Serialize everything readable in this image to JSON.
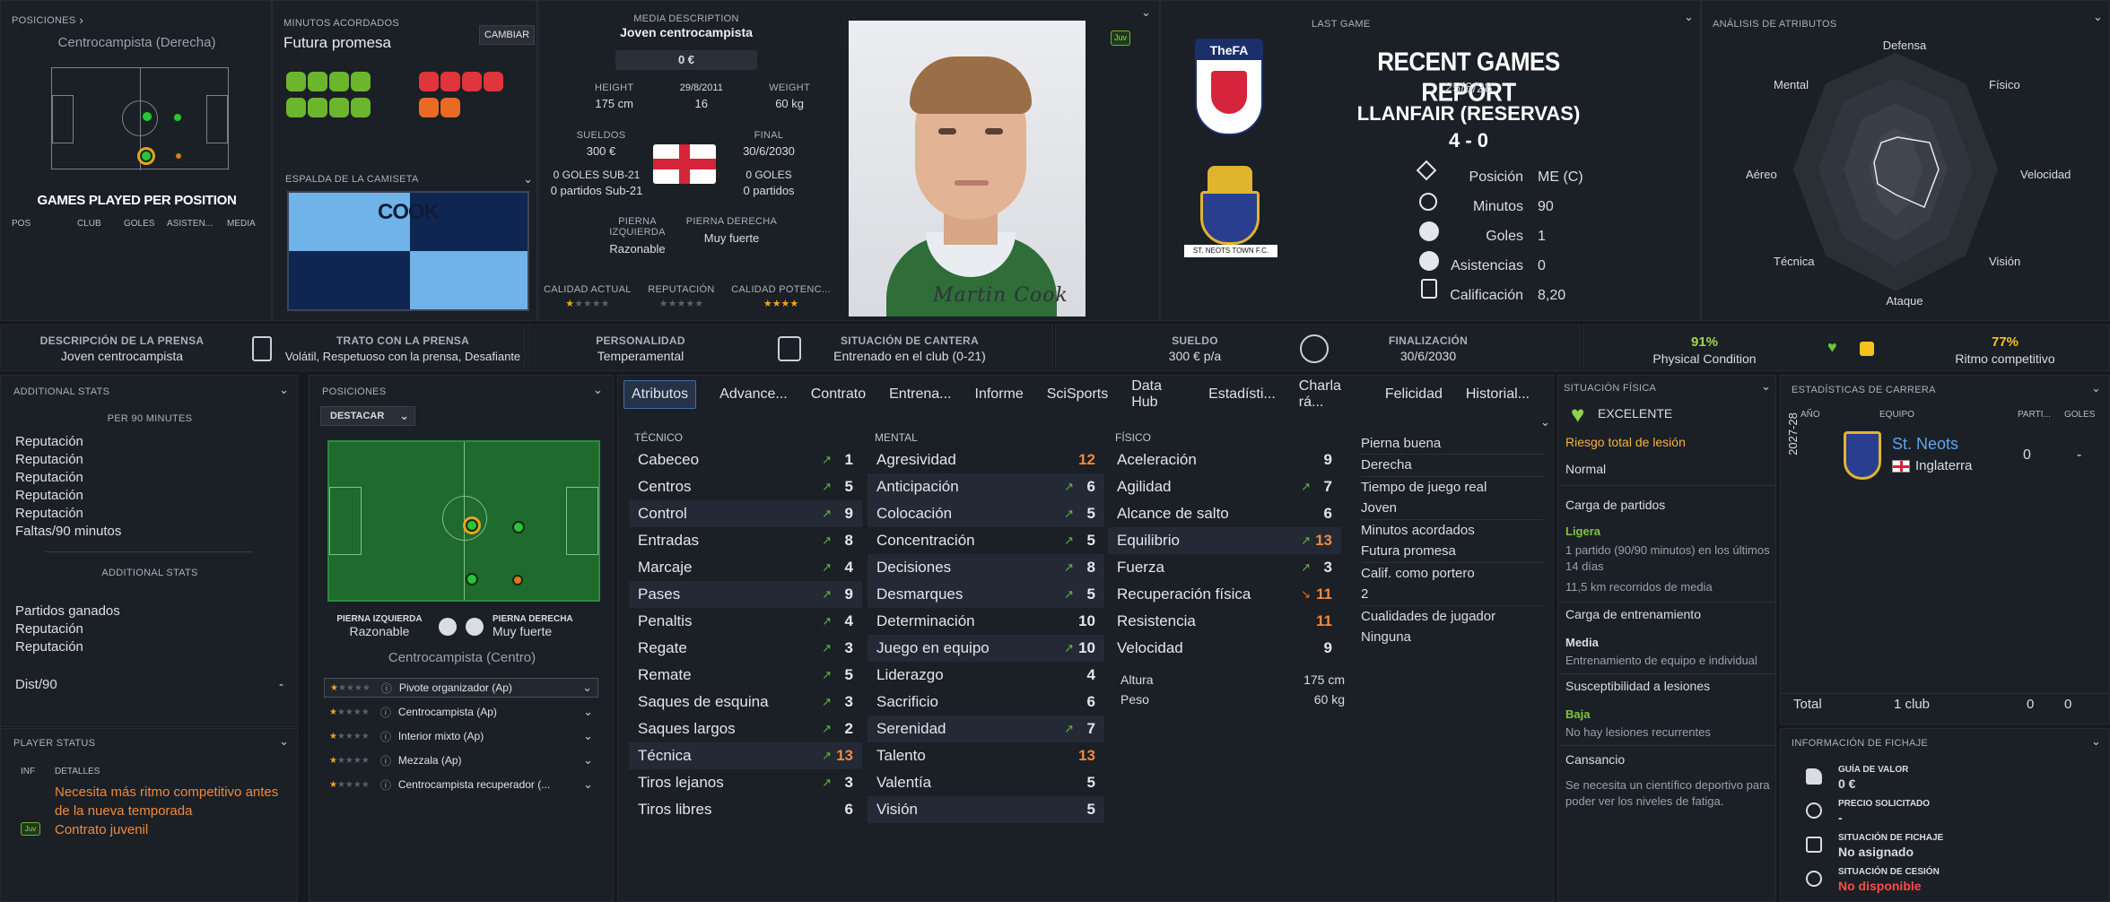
{
  "header_left": {
    "posiciones": "POSICIONES",
    "position_name": "Centrocampista (Derecha)",
    "games_played_title": "GAMES PLAYED PER POSITION",
    "cols": [
      "POS",
      "CLUB",
      "GOLES",
      "ASISTEN...",
      "MEDIA"
    ]
  },
  "minutos": {
    "label": "MINUTOS ACORDADOS",
    "value": "Futura promesa",
    "change_btn": "CAMBIAR"
  },
  "shirt": {
    "label": "ESPALDA DE LA CAMISETA",
    "name": "COOK"
  },
  "media": {
    "label": "MEDIA DESCRIPTION",
    "value": "Joven centrocampista",
    "value_money": "0 €",
    "badge": "Juv",
    "height_label": "HEIGHT",
    "height": "175 cm",
    "dob": "29/8/2011",
    "age": "16",
    "weight_label": "WEIGHT",
    "weight": "60 kg",
    "sueldos_label": "SUELDOS",
    "sueldos": "300 €",
    "final_label": "FINAL",
    "final": "30/6/2030",
    "goles_sub21": "0 GOLES SUB-21",
    "partidos_sub21": "0 partidos Sub-21",
    "goles": "0 GOLES",
    "partidos": "0 partidos",
    "pierna_izq_label": "PIERNA IZQUIERDA",
    "pierna_izq": "Razonable",
    "pierna_der_label": "PIERNA DERECHA",
    "pierna_der": "Muy fuerte",
    "calidad_actual": "CALIDAD ACTUAL",
    "reputacion": "REPUTACIÓN",
    "calidad_potencial": "CALIDAD POTENC...",
    "signature": "Martin Cook"
  },
  "last_game": {
    "label": "LAST GAME",
    "title": "RECENT GAMES REPORT",
    "date": "25/6/28",
    "opponent": "LLANFAIR (RESERVAS)",
    "score": "4 - 0",
    "badge_top": "TheFA",
    "badge_bottom": "ST. NEOTS TOWN F.C.",
    "rows": [
      {
        "k": "Posición",
        "v": "ME (C)"
      },
      {
        "k": "Minutos",
        "v": "90"
      },
      {
        "k": "Goles",
        "v": "1"
      },
      {
        "k": "Asistencias",
        "v": "0"
      },
      {
        "k": "Calificación",
        "v": "8,20"
      }
    ]
  },
  "analisis": {
    "label": "ANÁLISIS DE ATRIBUTOS",
    "axes": [
      "Defensa",
      "Físico",
      "Velocidad",
      "Visión",
      "Ataque",
      "Técnica",
      "Aéreo",
      "Mental"
    ]
  },
  "strip": {
    "prensa_label": "DESCRIPCIÓN DE LA PRENSA",
    "prensa": "Joven centrocampista",
    "trato_label": "TRATO CON LA PRENSA",
    "trato": "Volátil, Respetuoso con la prensa, Desafiante",
    "personalidad_label": "PERSONALIDAD",
    "personalidad": "Temperamental",
    "cantera_label": "SITUACIÓN DE CANTERA",
    "cantera": "Entrenado en el club (0-21)",
    "sueldo_label": "SUELDO",
    "sueldo": "300 € p/a",
    "finalizacion_label": "FINALIZACIÓN",
    "finalizacion": "30/6/2030",
    "physical_pct": "91%",
    "physical_label": "Physical Condition",
    "ritmo_pct": "77%",
    "ritmo_label": "Ritmo competitivo"
  },
  "additional": {
    "title": "ADDITIONAL STATS",
    "per90": "PER 90 MINUTES",
    "list1": [
      "Reputación",
      "Reputación",
      "Reputación",
      "Reputación",
      "Reputación",
      "Faltas/90 minutos"
    ],
    "sub": "ADDITIONAL STATS",
    "list2": [
      "Partidos ganados",
      "Reputación",
      "Reputación"
    ],
    "dist": "Dist/90",
    "dist_v": "-"
  },
  "player_status": {
    "title": "PLAYER STATUS",
    "inf": "INF",
    "detalles": "DETALLES",
    "msg1": "Necesita más ritmo competitivo antes de la nueva temporada",
    "badge": "Juv",
    "msg2": "Contrato juvenil"
  },
  "posiciones": {
    "title": "POSICIONES",
    "destacar": "DESTACAR",
    "pierna_izq_label": "PIERNA IZQUIERDA",
    "pierna_izq": "Razonable",
    "pierna_der_label": "PIERNA DERECHA",
    "pierna_der": "Muy fuerte",
    "position": "Centrocampista (Centro)",
    "roles": [
      "Pivote organizador (Ap)",
      "Centrocampista (Ap)",
      "Interior mixto (Ap)",
      "Mezzala (Ap)",
      "Centrocampista recuperador (..."
    ]
  },
  "tabs": [
    "Atributos",
    "Advance...",
    "Contrato",
    "Entrena...",
    "Informe",
    "SciSports",
    "Data Hub",
    "Estadísti...",
    "Charla rá...",
    "Felicidad",
    "Historial..."
  ],
  "tecnico": {
    "title": "TÉCNICO",
    "items": [
      {
        "n": "Cabeceo",
        "v": "1"
      },
      {
        "n": "Centros",
        "v": "5"
      },
      {
        "n": "Control",
        "v": "9"
      },
      {
        "n": "Entradas",
        "v": "8"
      },
      {
        "n": "Marcaje",
        "v": "4"
      },
      {
        "n": "Pases",
        "v": "9"
      },
      {
        "n": "Penaltis",
        "v": "4"
      },
      {
        "n": "Regate",
        "v": "3"
      },
      {
        "n": "Remate",
        "v": "5"
      },
      {
        "n": "Saques de esquina",
        "v": "3"
      },
      {
        "n": "Saques largos",
        "v": "2"
      },
      {
        "n": "Técnica",
        "v": "13"
      },
      {
        "n": "Tiros lejanos",
        "v": "3"
      },
      {
        "n": "Tiros libres",
        "v": "6"
      }
    ]
  },
  "mental": {
    "title": "MENTAL",
    "items": [
      {
        "n": "Agresividad",
        "v": "12"
      },
      {
        "n": "Anticipación",
        "v": "6"
      },
      {
        "n": "Colocación",
        "v": "5"
      },
      {
        "n": "Concentración",
        "v": "5"
      },
      {
        "n": "Decisiones",
        "v": "8"
      },
      {
        "n": "Desmarques",
        "v": "5"
      },
      {
        "n": "Determinación",
        "v": "10"
      },
      {
        "n": "Juego en equipo",
        "v": "10"
      },
      {
        "n": "Liderazgo",
        "v": "4"
      },
      {
        "n": "Sacrificio",
        "v": "6"
      },
      {
        "n": "Serenidad",
        "v": "7"
      },
      {
        "n": "Talento",
        "v": "13"
      },
      {
        "n": "Valentía",
        "v": "5"
      },
      {
        "n": "Visión",
        "v": "5"
      }
    ]
  },
  "fisico": {
    "title": "FÍSICO",
    "items": [
      {
        "n": "Aceleración",
        "v": "9"
      },
      {
        "n": "Agilidad",
        "v": "7"
      },
      {
        "n": "Alcance de salto",
        "v": "6"
      },
      {
        "n": "Equilibrio",
        "v": "13"
      },
      {
        "n": "Fuerza",
        "v": "3"
      },
      {
        "n": "Recuperación física",
        "v": "11"
      },
      {
        "n": "Resistencia",
        "v": "11"
      },
      {
        "n": "Velocidad",
        "v": "9"
      }
    ],
    "altura_label": "Altura",
    "altura": "175 cm",
    "peso_label": "Peso",
    "peso": "60 kg"
  },
  "info": {
    "items": [
      "Pierna buena",
      "Derecha",
      "Tiempo de juego real",
      "Joven",
      "Minutos acordados",
      "Futura promesa",
      "Calif. como portero",
      "2",
      "Cualidades de jugador",
      "Ninguna"
    ]
  },
  "situacion": {
    "title": "SITUACIÓN FÍSICA",
    "estado": "EXCELENTE",
    "riesgo": "Riesgo total de lesión",
    "riesgo_v": "Normal",
    "carga_partidos": "Carga de partidos",
    "carga_partidos_v": "Ligera",
    "carga_partidos_d1": "1 partido (90/90 minutos) en los últimos 14 días",
    "carga_partidos_d2": "11,5 km recorridos de media",
    "carga_entr": "Carga de entrenamiento",
    "carga_entr_v": "Media",
    "carga_entr_d": "Entrenamiento de equipo e individual",
    "suscept": "Susceptibilidad a lesiones",
    "suscept_v": "Baja",
    "suscept_d": "No hay lesiones recurrentes",
    "cansancio": "Cansancio",
    "cansancio_d": "Se necesita un científico deportivo para poder ver los niveles de fatiga."
  },
  "carrera": {
    "title": "ESTADÍSTICAS DE CARRERA",
    "cols": [
      "AÑO",
      "EQUIPO",
      "PARTI...",
      "GOLES"
    ],
    "year": "2027-28",
    "club": "St. Neots",
    "country": "Inglaterra",
    "parti": "0",
    "goles": "-",
    "total": "Total",
    "total_clubs": "1 club",
    "total_p": "0",
    "total_g": "0"
  },
  "fichaje": {
    "title": "INFORMACIÓN DE FICHAJE",
    "guia_label": "GUÍA DE VALOR",
    "guia": "0 €",
    "precio_label": "PRECIO SOLICITADO",
    "precio": "-",
    "sit_label": "SITUACIÓN DE FICHAJE",
    "sit": "No asignado",
    "cesion_label": "SITUACIÓN DE CESIÓN",
    "cesion": "No disponible"
  }
}
